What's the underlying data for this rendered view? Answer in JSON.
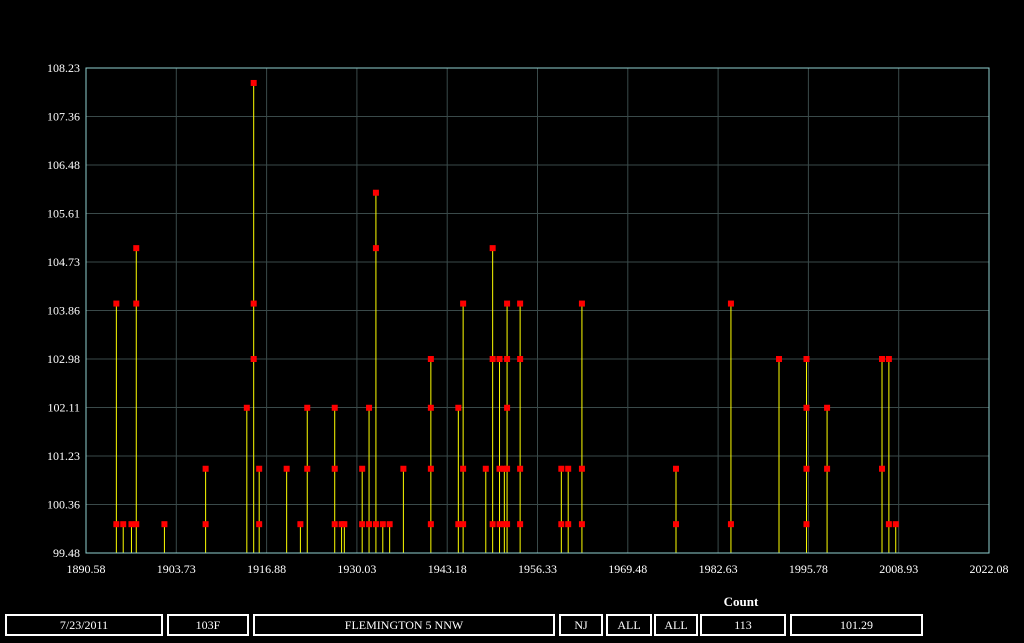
{
  "chart_data": {
    "type": "scatter",
    "title": "",
    "xlabel": "",
    "ylabel": "",
    "xlim": [
      1890.58,
      2022.08
    ],
    "ylim": [
      99.48,
      108.23
    ],
    "x_ticks": [
      "1890.58",
      "1903.73",
      "1916.88",
      "1930.03",
      "1943.18",
      "1956.33",
      "1969.48",
      "1982.63",
      "1995.78",
      "2008.93",
      "2022.08"
    ],
    "y_ticks": [
      "99.48",
      "100.36",
      "101.23",
      "102.11",
      "102.98",
      "103.86",
      "104.73",
      "105.61",
      "106.48",
      "107.36",
      "108.23"
    ],
    "grid": true,
    "stems": true,
    "colors": {
      "background": "#000000",
      "grid": "#3a4a4a",
      "axis": "#8fd0d0",
      "stem": "#ffff00",
      "marker": "#ff0000"
    },
    "points": [
      {
        "x": 1895.0,
        "y": 103.98
      },
      {
        "x": 1895.0,
        "y": 100.0
      },
      {
        "x": 1896.0,
        "y": 100.0
      },
      {
        "x": 1897.2,
        "y": 100.0
      },
      {
        "x": 1897.9,
        "y": 104.98
      },
      {
        "x": 1897.9,
        "y": 103.98
      },
      {
        "x": 1897.9,
        "y": 100.0
      },
      {
        "x": 1902.0,
        "y": 100.0
      },
      {
        "x": 1908.0,
        "y": 101.0
      },
      {
        "x": 1908.0,
        "y": 100.0
      },
      {
        "x": 1914.0,
        "y": 102.1
      },
      {
        "x": 1915.0,
        "y": 107.96
      },
      {
        "x": 1915.0,
        "y": 103.98
      },
      {
        "x": 1915.0,
        "y": 102.98
      },
      {
        "x": 1915.8,
        "y": 101.0
      },
      {
        "x": 1915.8,
        "y": 100.0
      },
      {
        "x": 1919.8,
        "y": 101.0
      },
      {
        "x": 1921.8,
        "y": 100.0
      },
      {
        "x": 1922.8,
        "y": 102.1
      },
      {
        "x": 1922.8,
        "y": 101.0
      },
      {
        "x": 1926.8,
        "y": 102.1
      },
      {
        "x": 1926.8,
        "y": 101.0
      },
      {
        "x": 1926.8,
        "y": 100.0
      },
      {
        "x": 1927.8,
        "y": 100.0
      },
      {
        "x": 1928.2,
        "y": 100.0
      },
      {
        "x": 1930.8,
        "y": 101.0
      },
      {
        "x": 1930.8,
        "y": 100.0
      },
      {
        "x": 1931.8,
        "y": 102.1
      },
      {
        "x": 1931.8,
        "y": 100.0
      },
      {
        "x": 1932.8,
        "y": 105.98
      },
      {
        "x": 1932.8,
        "y": 104.98
      },
      {
        "x": 1932.8,
        "y": 100.0
      },
      {
        "x": 1933.8,
        "y": 100.0
      },
      {
        "x": 1934.8,
        "y": 100.0
      },
      {
        "x": 1936.8,
        "y": 101.0
      },
      {
        "x": 1940.8,
        "y": 102.98
      },
      {
        "x": 1940.8,
        "y": 102.1
      },
      {
        "x": 1940.8,
        "y": 101.0
      },
      {
        "x": 1940.8,
        "y": 100.0
      },
      {
        "x": 1944.8,
        "y": 102.1
      },
      {
        "x": 1944.8,
        "y": 100.0
      },
      {
        "x": 1945.5,
        "y": 103.98
      },
      {
        "x": 1945.5,
        "y": 101.0
      },
      {
        "x": 1945.5,
        "y": 100.0
      },
      {
        "x": 1948.8,
        "y": 101.0
      },
      {
        "x": 1949.8,
        "y": 104.98
      },
      {
        "x": 1949.8,
        "y": 102.98
      },
      {
        "x": 1949.8,
        "y": 100.0
      },
      {
        "x": 1950.8,
        "y": 102.98
      },
      {
        "x": 1950.8,
        "y": 101.0
      },
      {
        "x": 1950.8,
        "y": 100.0
      },
      {
        "x": 1951.5,
        "y": 101.0
      },
      {
        "x": 1951.5,
        "y": 100.0
      },
      {
        "x": 1951.9,
        "y": 103.98
      },
      {
        "x": 1951.9,
        "y": 102.98
      },
      {
        "x": 1951.9,
        "y": 102.1
      },
      {
        "x": 1951.9,
        "y": 101.0
      },
      {
        "x": 1951.9,
        "y": 100.0
      },
      {
        "x": 1953.8,
        "y": 103.98
      },
      {
        "x": 1953.8,
        "y": 102.98
      },
      {
        "x": 1953.8,
        "y": 101.0
      },
      {
        "x": 1953.8,
        "y": 100.0
      },
      {
        "x": 1959.8,
        "y": 101.0
      },
      {
        "x": 1959.8,
        "y": 100.0
      },
      {
        "x": 1960.8,
        "y": 101.0
      },
      {
        "x": 1960.8,
        "y": 100.0
      },
      {
        "x": 1962.8,
        "y": 103.98
      },
      {
        "x": 1962.8,
        "y": 101.0
      },
      {
        "x": 1962.8,
        "y": 100.0
      },
      {
        "x": 1976.5,
        "y": 101.0
      },
      {
        "x": 1976.5,
        "y": 100.0
      },
      {
        "x": 1984.5,
        "y": 103.98
      },
      {
        "x": 1984.5,
        "y": 100.0
      },
      {
        "x": 1991.5,
        "y": 102.98
      },
      {
        "x": 1995.5,
        "y": 102.98
      },
      {
        "x": 1995.5,
        "y": 102.1
      },
      {
        "x": 1995.5,
        "y": 101.0
      },
      {
        "x": 1995.5,
        "y": 100.0
      },
      {
        "x": 1998.5,
        "y": 102.1
      },
      {
        "x": 1998.5,
        "y": 101.0
      },
      {
        "x": 2006.5,
        "y": 102.98
      },
      {
        "x": 2006.5,
        "y": 101.0
      },
      {
        "x": 2007.5,
        "y": 102.98
      },
      {
        "x": 2007.5,
        "y": 100.0
      },
      {
        "x": 2008.5,
        "y": 100.0
      }
    ]
  },
  "footer": {
    "count_label": "Count",
    "date": "7/23/2011",
    "temp": "103F",
    "station": "FLEMINGTON 5 NNW",
    "state": "NJ",
    "filter1": "ALL",
    "filter2": "ALL",
    "count": "113",
    "value": "101.29"
  }
}
